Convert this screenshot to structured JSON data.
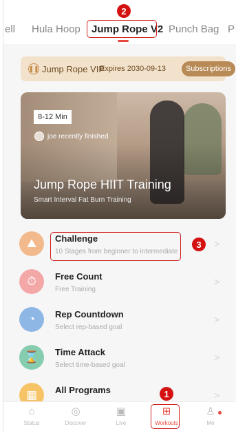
{
  "tabs": [
    {
      "label": "ell"
    },
    {
      "label": "Hula Hoop"
    },
    {
      "label": "Jump Rope V2",
      "active": true
    },
    {
      "label": "Punch Bag"
    },
    {
      "label": "P"
    }
  ],
  "vip": {
    "icon": "pause-circle-icon",
    "title": "Jump Rope VIP",
    "expires": "Expires 2030-09-13",
    "button": "Subscriptions"
  },
  "hero": {
    "tag": "8-12 Min",
    "user_text": "joe recently finished",
    "title": "Jump Rope HIIT Training",
    "subtitle": "Smart Interval Fat Burn Training"
  },
  "items": [
    {
      "title": "Challenge",
      "subtitle": "10 Stages from beginner to intermediate",
      "icon": "mountain-flag-icon",
      "color": "#f2b98c"
    },
    {
      "title": "Free Count",
      "subtitle": "Free Training",
      "icon": "stopwatch-icon",
      "color": "#f3a7a7"
    },
    {
      "title": "Rep Countdown",
      "subtitle": "Select rep-based goal",
      "icon": "countdown-timer-icon",
      "color": "#8fb7e6"
    },
    {
      "title": "Time Attack",
      "subtitle": "Select time-based goal",
      "icon": "hourglass-icon",
      "color": "#86cdb0"
    },
    {
      "title": "All Programs",
      "subtitle": "",
      "icon": "grid-icon",
      "color": "#f6c466"
    }
  ],
  "bottom_nav": [
    {
      "label": "Status",
      "icon": "home-icon"
    },
    {
      "label": "Discover",
      "icon": "compass-icon"
    },
    {
      "label": "Live",
      "icon": "live-tv-icon"
    },
    {
      "label": "Workouts",
      "icon": "workouts-plus-icon",
      "active": true
    },
    {
      "label": "Me",
      "icon": "person-icon"
    }
  ],
  "annotations": {
    "badge1": "1",
    "badge2": "2",
    "badge3": "3"
  },
  "colors": {
    "accent": "#e8473d",
    "annotation": "#d41212",
    "vip_bg": "#f3e2cb",
    "vip_button": "#b88a55"
  }
}
